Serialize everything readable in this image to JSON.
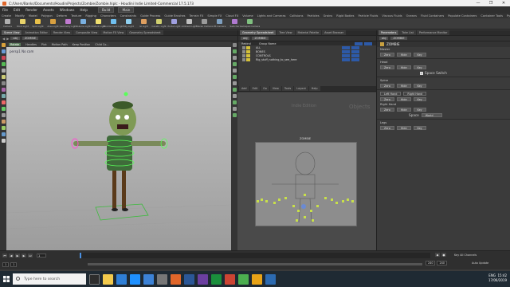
{
  "window": {
    "title": "C:/Users/Banks/Documents/HoudiniProjects/Zombie/Zombie.hiplc - Houdini Indie Limited-Commercial 17.5.173",
    "controls": [
      "—",
      "❐",
      "✕"
    ]
  },
  "menubar": {
    "items": [
      "File",
      "Edit",
      "Render",
      "Assets",
      "Windows",
      "Help"
    ],
    "mode": "Build",
    "desktop": "Main"
  },
  "shelf_tabs": [
    "Create",
    "Modify",
    "Model",
    "Polygon",
    "Deform",
    "Texture",
    "Rigging",
    "Characters",
    "Constraints",
    "Guide Process",
    "Guide Brushes",
    "Terrain FX",
    "Simple FX",
    "Cloud FX",
    "Volume",
    "Lights and Cameras",
    "Collisions",
    "Particles",
    "Grains",
    "Rigid Bodies",
    "Particle Fluids",
    "Viscous Fluids",
    "Oceans",
    "Fluid Containers",
    "Populate Containers",
    "Container Tools",
    "Pyro FX",
    "Sparse Pyro FX",
    "FEM",
    "Wires",
    "Crowds",
    "Drive Simulation"
  ],
  "shelf_tools": [
    "Camera",
    "Point Light",
    "Spot Light",
    "Area Light",
    "Geometry Light",
    "Volume Light",
    "Distant Light",
    "Environment Light",
    "Sky Light",
    "GI Light",
    "Caustic Light",
    "Portal Light",
    "Ambient Light",
    "Stereo Camera",
    "VR Camera",
    "Switcher",
    "Gamepad Camera"
  ],
  "viewport_pane": {
    "tabs": [
      "Scene View",
      "Animation Editor",
      "Render View",
      "Composite View",
      "Motion FX View",
      "Geometry Spreadsheet"
    ],
    "path": [
      "obj",
      "ZOMBIE"
    ],
    "options": [
      "Rotate",
      "Handles",
      "Pick",
      "Motion Path",
      "Keep Position",
      "Child Co..."
    ],
    "label": "persp1  No cam"
  },
  "middle_pane": {
    "tabs": [
      "Geometry Spreadsheet",
      "Tree View",
      "Material Palette",
      "Asset Browser"
    ],
    "path": [
      "obj",
      "ZOMBIE"
    ],
    "menu": [
      "Add",
      "Edit",
      "Go",
      "View",
      "Tools",
      "Layout",
      "Help"
    ],
    "list_header": [
      "Rebind",
      "Group Name"
    ],
    "list_rows": [
      "ALL",
      "BONES",
      "CONTROLS",
      "Rig_stuff_nothing_to_see_here"
    ],
    "net_label": "Indie Edition",
    "net_context": "Objects",
    "node_label": "ZOMBIE"
  },
  "params_pane": {
    "tabs": [
      "Parameters",
      "Take List",
      "Performance Monitor"
    ],
    "path": [
      "obj",
      "ZOMBIE"
    ],
    "node_name": "ZOMBIE",
    "sections": [
      {
        "label": "Master",
        "buttons": [
          "Zero",
          "Hide",
          "Key"
        ]
      },
      {
        "label": "Head",
        "buttons": [
          "Zero",
          "Hide",
          "Key"
        ],
        "toggle": "Space Switch"
      },
      {
        "label": "Spine",
        "buttons": [
          "Zero",
          "Hide",
          "Key"
        ]
      },
      {
        "label": "Left Hand",
        "buttons": [
          "Zero",
          "Hide",
          "Key"
        ],
        "extra": "Right Hand"
      },
      {
        "label": "Right Hand",
        "buttons": [
          "Zero",
          "Hide",
          "Key"
        ],
        "space": "World"
      },
      {
        "label": "Legs",
        "buttons": [
          "Zero",
          "Hide",
          "Key"
        ]
      }
    ],
    "footer": [
      "Key All Channels",
      "Auto Update"
    ]
  },
  "timeline": {
    "current_frame": "1",
    "start_frame": "1",
    "end_frame": "240",
    "range_start": "1",
    "range_end": "240"
  },
  "taskbar": {
    "search_placeholder": "Type here to search",
    "language": "ENG",
    "time": "15:42",
    "date": "17/06/2019"
  },
  "colors": {
    "viewport_top": "#c9c9c9",
    "grid_green": "#3dbb3d",
    "accent_orange": "#e0662a",
    "list_blue": "#2d5aa8"
  }
}
